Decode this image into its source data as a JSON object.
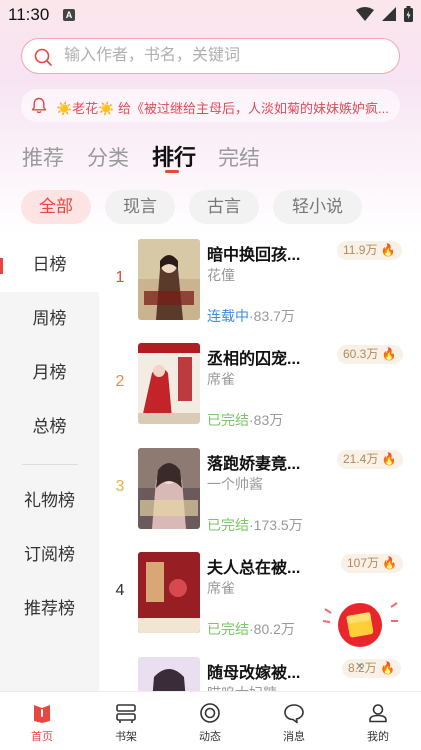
{
  "status_bar": {
    "time": "11:30",
    "notification_icon": "A"
  },
  "search": {
    "placeholder": "输入作者，书名，关键词"
  },
  "notice": {
    "text": "☀️老花☀️ 给《被过继给主母后，人淡如菊的妹妹嫉妒疯..."
  },
  "tabs": [
    {
      "label": "推荐"
    },
    {
      "label": "分类"
    },
    {
      "label": "排行",
      "active": true
    },
    {
      "label": "完结"
    }
  ],
  "chips": [
    {
      "label": "全部",
      "active": true
    },
    {
      "label": "现言"
    },
    {
      "label": "古言"
    },
    {
      "label": "轻小说"
    }
  ],
  "sidebar": {
    "items": [
      {
        "label": "日榜",
        "active": true
      },
      {
        "label": "周榜"
      },
      {
        "label": "月榜"
      },
      {
        "label": "总榜"
      },
      {
        "label": "礼物榜"
      },
      {
        "label": "订阅榜"
      },
      {
        "label": "推荐榜"
      }
    ]
  },
  "books": [
    {
      "rank": "1",
      "title": "暗中换回孩...",
      "author": "花僮",
      "status": "连载中",
      "words": "·83.7万",
      "heat": "11.9万",
      "status_color": "#3a8de0",
      "rank_color": "#e8463f"
    },
    {
      "rank": "2",
      "title": "丞相的囚宠...",
      "author": "席雀",
      "status": "已完结",
      "words": "·83万",
      "heat": "60.3万",
      "status_color": "#7cc36a",
      "rank_color": "#e8903f"
    },
    {
      "rank": "3",
      "title": "落跑娇妻竟...",
      "author": "一个帅酱",
      "status": "已完结",
      "words": "·173.5万",
      "heat": "21.4万",
      "status_color": "#7cc36a",
      "rank_color": "#e0b24a"
    },
    {
      "rank": "4",
      "title": "夫人总在被...",
      "author": "席雀",
      "status": "已完结",
      "words": "·80.2万",
      "heat": "107万",
      "status_color": "#7cc36a",
      "rank_color": "#333333"
    },
    {
      "rank": "",
      "title": "随母改嫁被...",
      "author": "喵呜大妃糖",
      "status": "",
      "words": "",
      "heat": "8.2万",
      "status_color": "#7cc36a",
      "rank_color": "#333333"
    }
  ],
  "bottom_nav": [
    {
      "label": "首页",
      "icon": "home-book-icon",
      "active": true
    },
    {
      "label": "书架",
      "icon": "bookshelf-icon"
    },
    {
      "label": "动态",
      "icon": "activity-icon"
    },
    {
      "label": "消息",
      "icon": "message-bubble-icon"
    },
    {
      "label": "我的",
      "icon": "profile-icon"
    }
  ],
  "colors": {
    "accent": "#e8463f",
    "search_border": "#f0a8ae",
    "notice_text": "#e04b58"
  }
}
